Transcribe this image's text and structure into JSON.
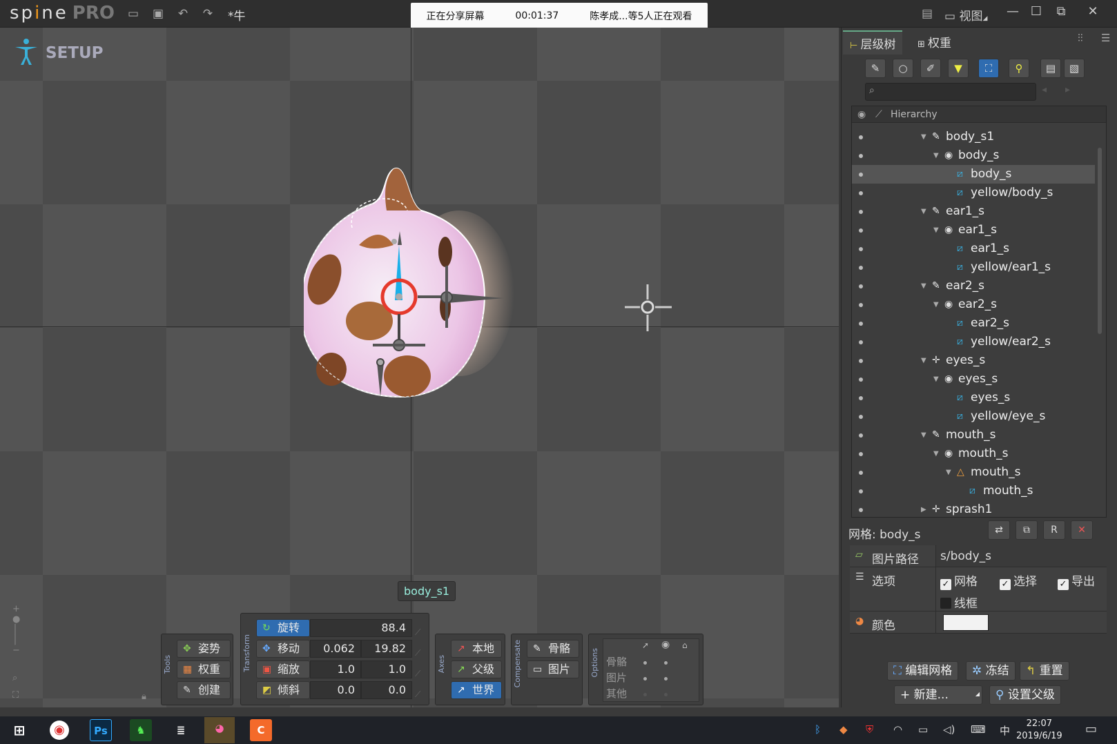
{
  "titlebar": {
    "logo": "sp",
    "logo_mid": "i",
    "logo_end": "ne",
    "logo_pro": "PRO",
    "project": "*牛",
    "share_status": "正在分享屏幕",
    "share_time": "00:01:37",
    "share_viewers": "陈孝成...等5人正在观看",
    "view_label": "视图"
  },
  "viewport": {
    "mode_label": "SETUP",
    "bone_label": "body_s1"
  },
  "tools": {
    "title": "Tools",
    "pose": "姿势",
    "weights": "权重",
    "create": "创建"
  },
  "transform": {
    "title": "Transform",
    "rotate": "旋转",
    "rotate_value": "88.4",
    "translate": "移动",
    "translate_x": "0.062",
    "translate_y": "19.82",
    "scale": "缩放",
    "scale_x": "1.0",
    "scale_y": "1.0",
    "shear": "倾斜",
    "shear_x": "0.0",
    "shear_y": "0.0"
  },
  "axes": {
    "title": "Axes",
    "local": "本地",
    "parent": "父级",
    "world": "世界"
  },
  "compensate": {
    "title": "Compensate",
    "bones": "骨骼",
    "images": "图片"
  },
  "options": {
    "title": "Options",
    "bones": "骨骼",
    "images": "图片",
    "others": "其他"
  },
  "panel": {
    "tab_tree": "层级树",
    "tab_weights": "权重",
    "search_placeholder": "",
    "tree_header": "Hierarchy",
    "tree": [
      {
        "label": "body_s1",
        "depth": 0,
        "kind": "bone"
      },
      {
        "label": "body_s",
        "depth": 1,
        "kind": "slot"
      },
      {
        "label": "body_s",
        "depth": 2,
        "kind": "mesh",
        "selected": true
      },
      {
        "label": "yellow/body_s",
        "depth": 2,
        "kind": "mesh"
      },
      {
        "label": "ear1_s",
        "depth": 0,
        "kind": "bone"
      },
      {
        "label": "ear1_s",
        "depth": 1,
        "kind": "slot"
      },
      {
        "label": "ear1_s",
        "depth": 2,
        "kind": "mesh"
      },
      {
        "label": "yellow/ear1_s",
        "depth": 2,
        "kind": "mesh"
      },
      {
        "label": "ear2_s",
        "depth": 0,
        "kind": "bone"
      },
      {
        "label": "ear2_s",
        "depth": 1,
        "kind": "slot"
      },
      {
        "label": "ear2_s",
        "depth": 2,
        "kind": "mesh"
      },
      {
        "label": "yellow/ear2_s",
        "depth": 2,
        "kind": "mesh"
      },
      {
        "label": "eyes_s",
        "depth": 0,
        "kind": "cross"
      },
      {
        "label": "eyes_s",
        "depth": 1,
        "kind": "slot"
      },
      {
        "label": "eyes_s",
        "depth": 2,
        "kind": "mesh"
      },
      {
        "label": "yellow/eye_s",
        "depth": 2,
        "kind": "mesh"
      },
      {
        "label": "mouth_s",
        "depth": 0,
        "kind": "bone"
      },
      {
        "label": "mouth_s",
        "depth": 1,
        "kind": "slot"
      },
      {
        "label": "mouth_s",
        "depth": 2,
        "kind": "skin"
      },
      {
        "label": "mouth_s",
        "depth": 3,
        "kind": "mesh"
      },
      {
        "label": "sprash1",
        "depth": 0,
        "kind": "cross"
      }
    ]
  },
  "props": {
    "title": "网格: body_s",
    "image_path_label": "图片路径",
    "image_path_value": "s/body_s",
    "options_label": "选项",
    "opt_mesh": "网格",
    "opt_select": "选择",
    "opt_export": "导出",
    "opt_wireframe": "线框",
    "color_label": "颜色",
    "color_value": "#f2f2f2",
    "edit_mesh": "编辑网格",
    "freeze": "冻结",
    "reset": "重置",
    "new": "新建...",
    "set_parent": "设置父级"
  },
  "taskbar": {
    "ps": "Ps",
    "time": "22:07",
    "date": "2019/6/19",
    "ime": "中"
  },
  "colors": {
    "accent": "#2f6cb0",
    "selection": "#555555",
    "bone_blue": "#1ab0e8",
    "root_red": "#e53a2c"
  }
}
